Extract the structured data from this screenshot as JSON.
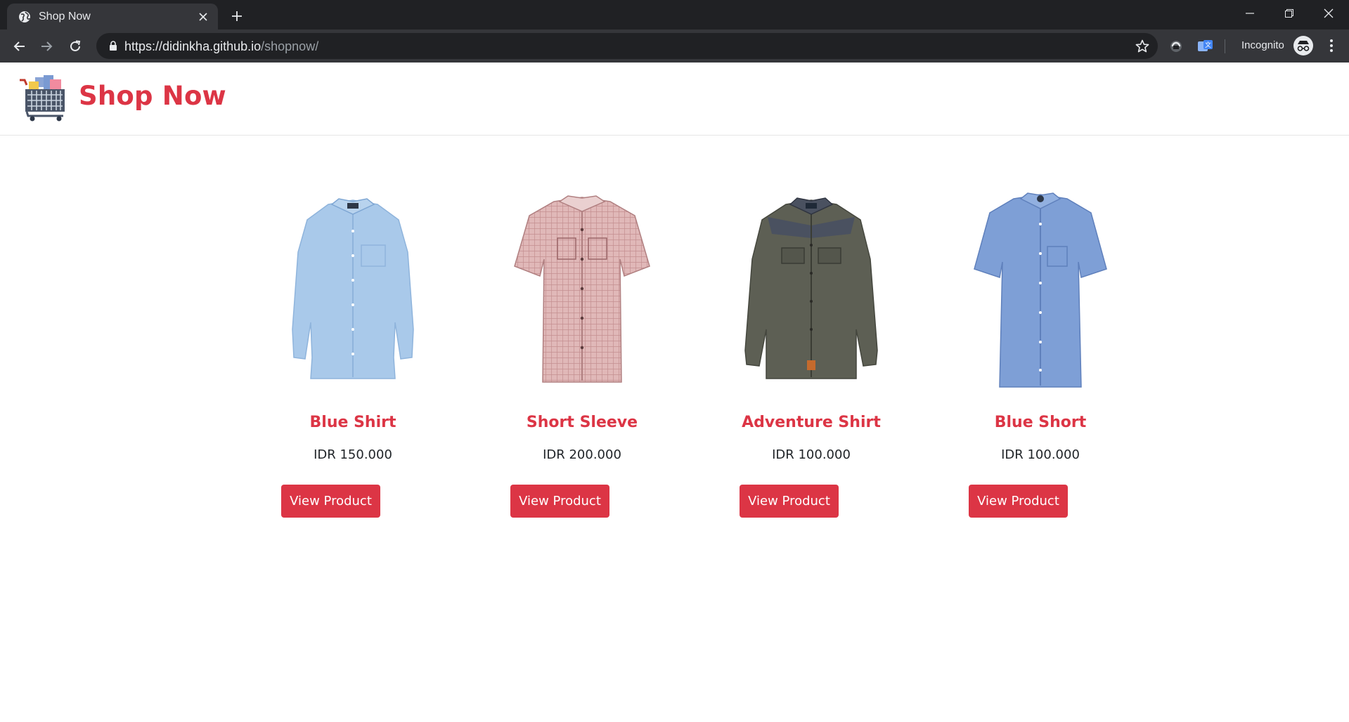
{
  "browser": {
    "tab_title": "Shop Now",
    "url_host": "https://didinkha.github.io",
    "url_path": "/shopnow/",
    "incognito_label": "Incognito",
    "icons": [
      "globe-icon",
      "close-icon",
      "plus-icon",
      "minimize-icon",
      "restore-icon",
      "window-close-icon",
      "back-icon",
      "forward-icon",
      "reload-icon",
      "lock-icon",
      "star-icon",
      "extension-icon",
      "translate-icon",
      "incognito-icon",
      "more-vert-icon"
    ]
  },
  "header": {
    "brand": "Shop Now",
    "logo_icon": "shopping-cart-icon"
  },
  "colors": {
    "accent": "#dc3545",
    "chrome_dark": "#202124",
    "chrome_tab": "#35363a"
  },
  "products": [
    {
      "name": "Blue Shirt",
      "price": "IDR 150.000",
      "button": "View Product",
      "image": "long-sleeve-light-blue-shirt"
    },
    {
      "name": "Short Sleeve",
      "price": "IDR 200.000",
      "button": "View Product",
      "image": "short-sleeve-red-check-shirt"
    },
    {
      "name": "Adventure Shirt",
      "price": "IDR 100.000",
      "button": "View Product",
      "image": "long-sleeve-olive-flannel-shirt"
    },
    {
      "name": "Blue Short",
      "price": "IDR 100.000",
      "button": "View Product",
      "image": "short-sleeve-blue-linen-shirt"
    }
  ]
}
